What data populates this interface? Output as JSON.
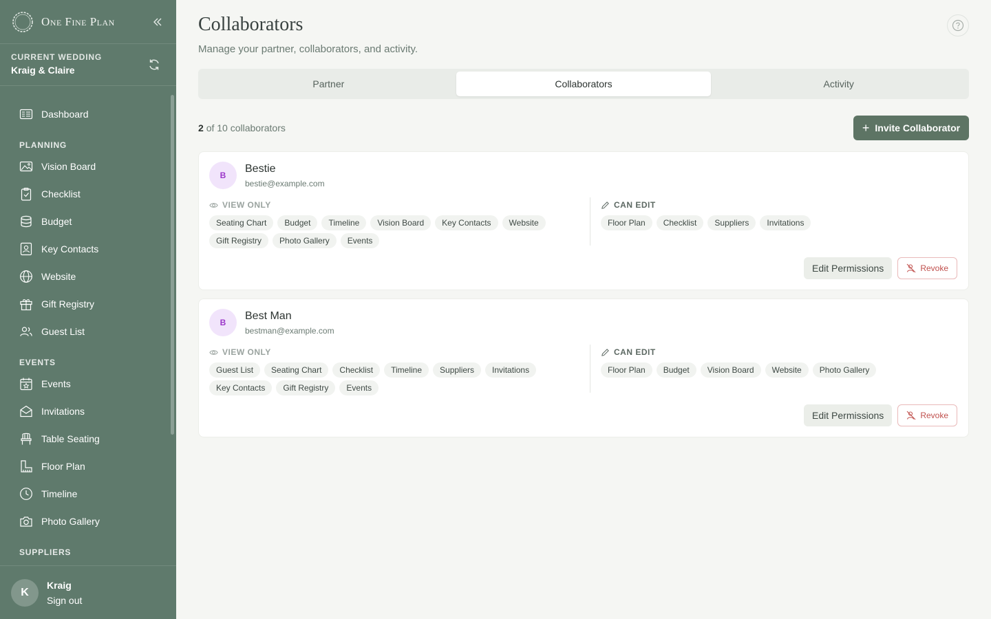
{
  "brand": {
    "name": "One Fine Plan"
  },
  "wedding": {
    "label": "CURRENT WEDDING",
    "name": "Kraig & Claire"
  },
  "nav": {
    "dashboard": "Dashboard",
    "planning_label": "PLANNING",
    "planning": [
      "Vision Board",
      "Checklist",
      "Budget",
      "Key Contacts",
      "Website",
      "Gift Registry",
      "Guest List"
    ],
    "events_label": "EVENTS",
    "events": [
      "Events",
      "Invitations",
      "Table Seating",
      "Floor Plan",
      "Timeline",
      "Photo Gallery"
    ],
    "suppliers_label": "SUPPLIERS"
  },
  "user": {
    "initial": "K",
    "name": "Kraig",
    "signout": "Sign out"
  },
  "page": {
    "title": "Collaborators",
    "subtitle": "Manage your partner, collaborators, and activity."
  },
  "tabs": [
    "Partner",
    "Collaborators",
    "Activity"
  ],
  "collab_count": {
    "current": "2",
    "rest": "of 10 collaborators"
  },
  "invite_label": "Invite Collaborator",
  "labels": {
    "view_only": "VIEW ONLY",
    "can_edit": "CAN EDIT",
    "edit_permissions": "Edit Permissions",
    "revoke": "Revoke"
  },
  "collaborators": [
    {
      "initial": "B",
      "name": "Bestie",
      "email": "bestie@example.com",
      "view_only": [
        "Seating Chart",
        "Budget",
        "Timeline",
        "Vision Board",
        "Key Contacts",
        "Website",
        "Gift Registry",
        "Photo Gallery",
        "Events"
      ],
      "can_edit": [
        "Floor Plan",
        "Checklist",
        "Suppliers",
        "Invitations"
      ]
    },
    {
      "initial": "B",
      "name": "Best Man",
      "email": "bestman@example.com",
      "view_only": [
        "Guest List",
        "Seating Chart",
        "Checklist",
        "Timeline",
        "Suppliers",
        "Invitations",
        "Key Contacts",
        "Gift Registry",
        "Events"
      ],
      "can_edit": [
        "Floor Plan",
        "Budget",
        "Vision Board",
        "Website",
        "Photo Gallery"
      ]
    }
  ],
  "colors": {
    "sidebar": "#5f7a6c",
    "primary_button": "#5d7464",
    "avatar_bg": "#f1e4fb",
    "avatar_text": "#9b36c9",
    "revoke": "#c0504d"
  }
}
